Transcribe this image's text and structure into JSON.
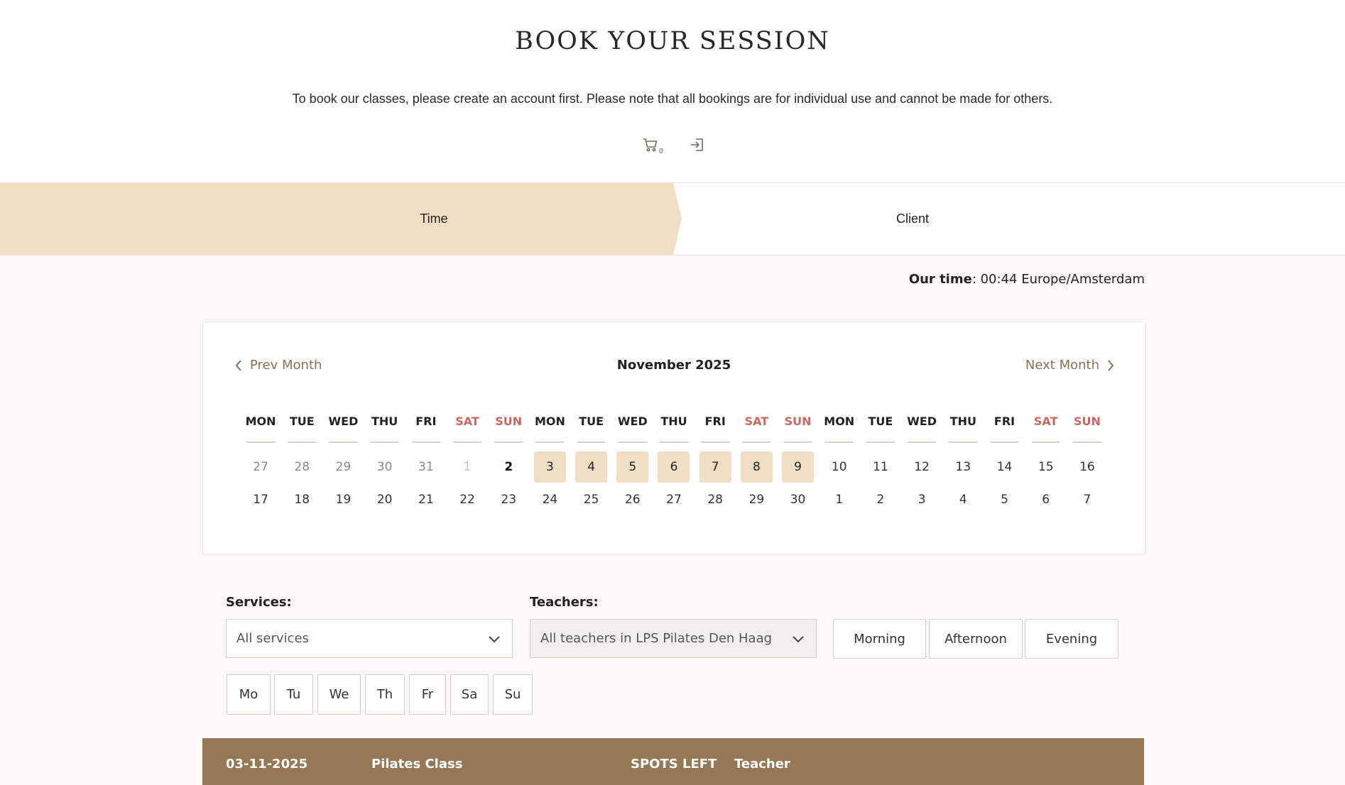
{
  "header": {
    "title": "BOOK YOUR SESSION",
    "intro": "To book our classes, please create an account first. Please note that all bookings are for individual use and cannot be made for others.",
    "cart_count": "0"
  },
  "stepper": {
    "steps": [
      {
        "label": "Time",
        "active": true
      },
      {
        "label": "Client",
        "active": false
      }
    ]
  },
  "our_time": {
    "label": "Our time",
    "value": ": 00:44 Europe/Amsterdam"
  },
  "calendar": {
    "prev_label": "Prev Month",
    "next_label": "Next Month",
    "month": "November 2025",
    "weekdays": [
      "MON",
      "TUE",
      "WED",
      "THU",
      "FRI",
      "SAT",
      "SUN",
      "MON",
      "TUE",
      "WED",
      "THU",
      "FRI",
      "SAT",
      "SUN",
      "MON",
      "TUE",
      "WED",
      "THU",
      "FRI",
      "SAT",
      "SUN"
    ],
    "row1": [
      "27",
      "28",
      "29",
      "30",
      "31",
      "1",
      "2",
      "3",
      "4",
      "5",
      "6",
      "7",
      "8",
      "9",
      "10",
      "11",
      "12",
      "13",
      "14",
      "15",
      "16"
    ],
    "row2": [
      "17",
      "18",
      "19",
      "20",
      "21",
      "22",
      "23",
      "24",
      "25",
      "26",
      "27",
      "28",
      "29",
      "30",
      "1",
      "2",
      "3",
      "4",
      "5",
      "6",
      "7"
    ],
    "weekend_color": "#c8685e",
    "available_color": "#f0dfc5"
  },
  "filters": {
    "services_label": "Services:",
    "services_value": "All services",
    "teachers_label": "Teachers:",
    "teachers_value": "All teachers in LPS Pilates Den Haag",
    "time_of_day": [
      "Morning",
      "Afternoon",
      "Evening"
    ],
    "days": [
      "Mo",
      "Tu",
      "We",
      "Th",
      "Fr",
      "Sa",
      "Su"
    ]
  },
  "results": {
    "date": "03-11-2025",
    "class": "Pilates Class",
    "spots": "SPOTS LEFT",
    "teacher": "Teacher",
    "bar_color": "#977855"
  },
  "colors": {
    "accent": "#977855",
    "active_step": "#f0dfc5",
    "link": "#8a7055"
  }
}
